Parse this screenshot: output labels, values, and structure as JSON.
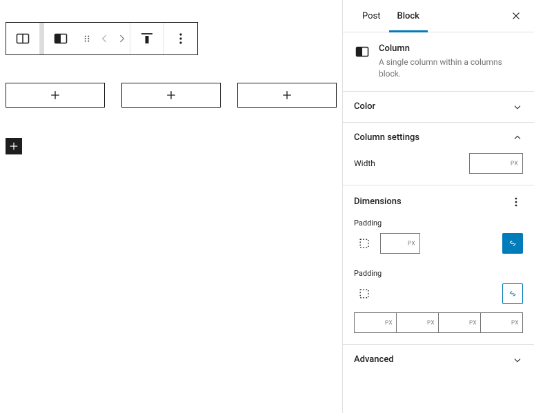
{
  "sidebar_tabs": {
    "post": "Post",
    "block": "Block"
  },
  "block_card": {
    "title": "Column",
    "description": "A single column within a columns block."
  },
  "panels": {
    "color": "Color",
    "column_settings": "Column settings",
    "dimensions": "Dimensions",
    "advanced": "Advanced"
  },
  "controls": {
    "width_label": "Width",
    "width_unit": "PX",
    "padding_label": "Padding",
    "padding_unit": "PX"
  }
}
